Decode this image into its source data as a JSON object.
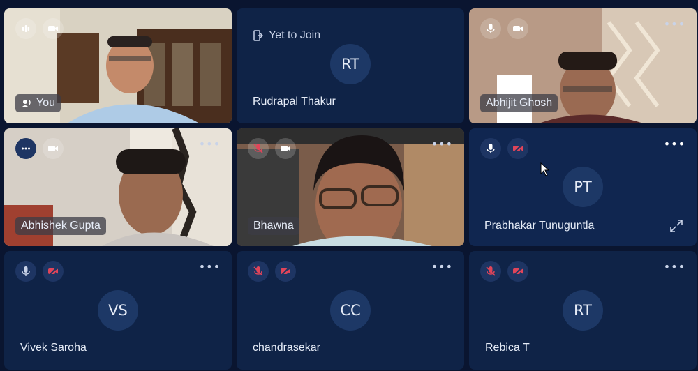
{
  "participants": [
    {
      "name": "You",
      "initials": "",
      "has_video": true,
      "mic": "active",
      "cam": "on",
      "speaker_icon": true
    },
    {
      "name": "Rudrapal Thakur",
      "initials": "RT",
      "has_video": false,
      "status": "Yet to Join"
    },
    {
      "name": "Abhijit Ghosh",
      "initials": "",
      "has_video": true,
      "mic": "on",
      "cam": "on"
    },
    {
      "name": "Abhishek Gupta",
      "initials": "",
      "has_video": true,
      "mic": "active",
      "cam": "on"
    },
    {
      "name": "Bhawna",
      "initials": "",
      "has_video": true,
      "mic": "off",
      "cam": "on"
    },
    {
      "name": "Prabhakar Tunuguntla",
      "initials": "PT",
      "has_video": false,
      "mic": "on",
      "cam": "off"
    },
    {
      "name": "Vivek Saroha",
      "initials": "VS",
      "has_video": false,
      "mic": "on",
      "cam": "off"
    },
    {
      "name": "chandrasekar",
      "initials": "CC",
      "has_video": false,
      "mic": "off",
      "cam": "off"
    },
    {
      "name": "Rebica T",
      "initials": "RT",
      "has_video": false,
      "mic": "off",
      "cam": "off"
    }
  ],
  "colors": {
    "background": "#0a1530",
    "tile": "#0f2347",
    "avatar": "#1d3866",
    "muted_red": "#e0455a"
  },
  "more_glyph": "•••"
}
